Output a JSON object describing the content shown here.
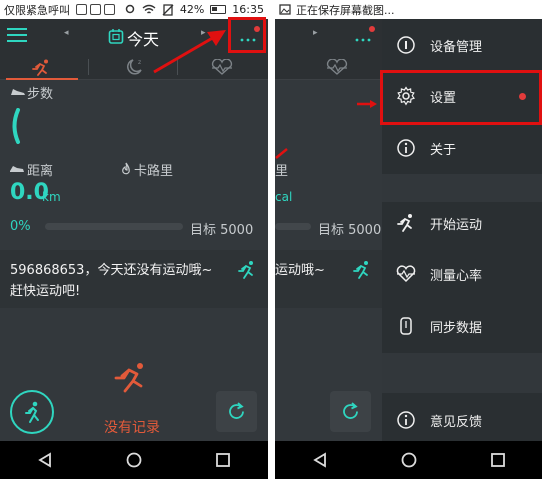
{
  "left_screen": {
    "statusbar": {
      "carrier_text": "仅限紧急呼叫",
      "battery": "42%",
      "time": "16:35"
    },
    "appbar": {
      "title": "今天"
    },
    "steps": {
      "label": "步数"
    },
    "distance": {
      "label": "距离",
      "value": "0.0",
      "unit": "km"
    },
    "calories": {
      "label": "卡路里"
    },
    "goal": {
      "percent": "0%",
      "text": "目标 5000",
      "progress": 0
    },
    "message": {
      "line1": "596868653，今天还没有运动哦~",
      "line2": "赶快运动吧!"
    },
    "empty_state": {
      "label": "没有记录"
    }
  },
  "right_screen": {
    "statusbar": {
      "notification_text": "正在保存屏幕截图..."
    },
    "behind": {
      "partial_label": "里",
      "partial_unit": "cal",
      "goal_text": "目标 5000",
      "message_partial": "运动哦~"
    },
    "drawer": {
      "items": [
        {
          "label": "设备管理",
          "icon": "info-circle-icon"
        },
        {
          "label": "设置",
          "icon": "gear-icon",
          "badge": true
        },
        {
          "label": "关于",
          "icon": "info-circle-icon"
        },
        {
          "label": "开始运动",
          "icon": "running-icon"
        },
        {
          "label": "测量心率",
          "icon": "heart-rate-icon"
        },
        {
          "label": "同步数据",
          "icon": "sync-band-icon"
        },
        {
          "label": "意见反馈",
          "icon": "info-circle-icon"
        }
      ]
    }
  },
  "colors": {
    "accent_teal": "#2fd6c0",
    "accent_orange": "#e25a3a",
    "annotation_red": "#e01010",
    "background": "#2c3033"
  }
}
